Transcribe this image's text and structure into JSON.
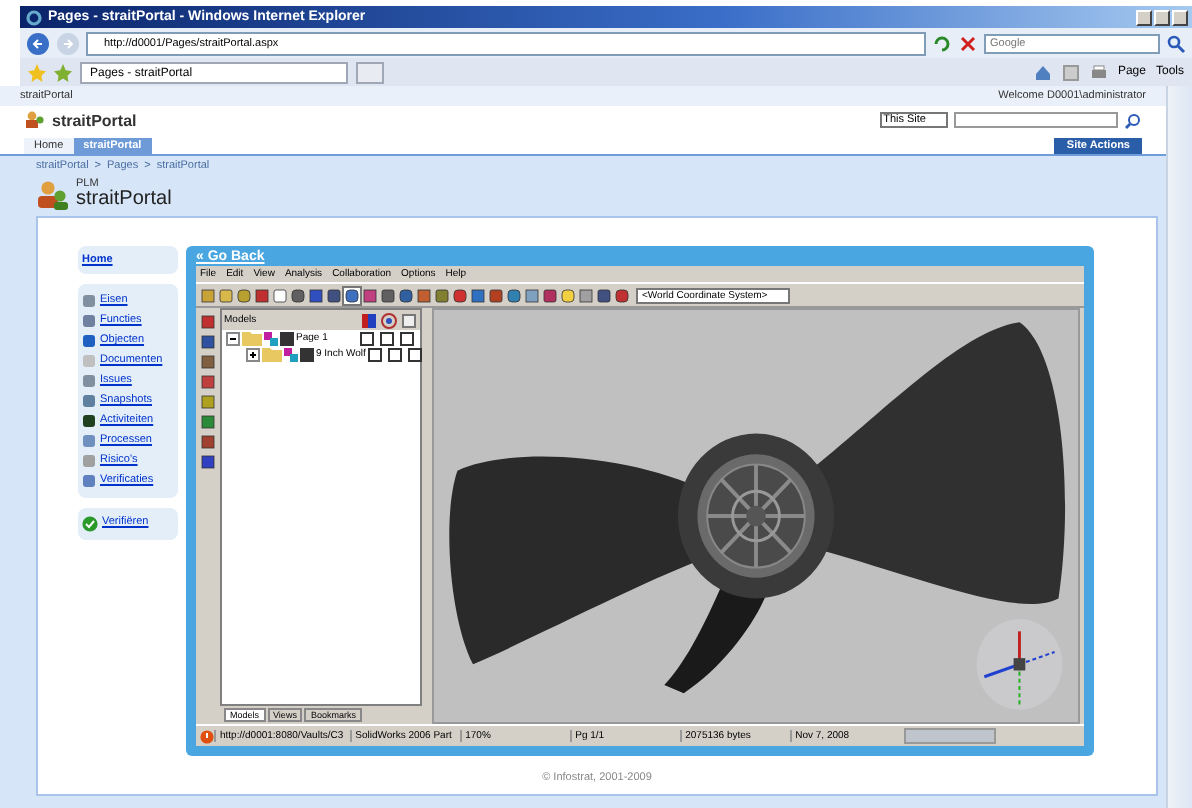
{
  "window": {
    "title": "Pages - straitPortal - Windows Internet Explorer"
  },
  "browser": {
    "address": "http://d0001/Pages/straitPortal.aspx",
    "search_placeholder": "Google",
    "tab": "Pages - straitPortal",
    "commands": [
      "Page",
      "Tools"
    ]
  },
  "site": {
    "strip_title": "straitPortal",
    "welcome": "Welcome D0001\\administrator",
    "name": "straitPortal",
    "scope": "This Site",
    "site_actions": "Site Actions",
    "tabs": [
      {
        "label": "Home",
        "selected": false
      },
      {
        "label": "straitPortal",
        "selected": true
      }
    ],
    "breadcrumb": [
      "straitPortal",
      "Pages",
      "straitPortal"
    ],
    "breadcrumb_separator": ">",
    "page_subtitle": "PLM",
    "page_title": "straitPortal"
  },
  "left_nav": {
    "home": "Home",
    "items": [
      "Eisen",
      "Functies",
      "Objecten",
      "Documenten",
      "Issues",
      "Snapshots",
      "Activiteiten",
      "Processen",
      "Risico's",
      "Verificaties"
    ],
    "verify": "Verifiëren"
  },
  "viewer": {
    "go_back": "« Go Back",
    "menus": [
      "File",
      "Edit",
      "View",
      "Analysis",
      "Collaboration",
      "Options",
      "Help"
    ],
    "coordinate_system": "<World Coordinate System>",
    "panel_title": "Models",
    "tree": [
      {
        "label": "Page 1",
        "expanded": true,
        "checked": true,
        "flags": [
          false,
          false,
          false
        ],
        "children": [
          {
            "label": "9 Inch Wolf",
            "expanded": false,
            "checked": true,
            "flags": [
              false,
              false,
              false
            ]
          }
        ]
      }
    ],
    "panel_tabs": [
      {
        "label": "Models",
        "selected": true
      },
      {
        "label": "Views",
        "selected": false
      },
      {
        "label": "Bookmarks",
        "selected": false
      }
    ],
    "status": [
      "http://d0001:8080/Vaults/C3",
      "SolidWorks 2006 Part",
      "170%",
      "Pg 1/1",
      "2075136 bytes",
      "Nov 7, 2008"
    ],
    "progress": {
      "level": 0
    }
  },
  "footer": "© Infostrat, 2001-2009"
}
